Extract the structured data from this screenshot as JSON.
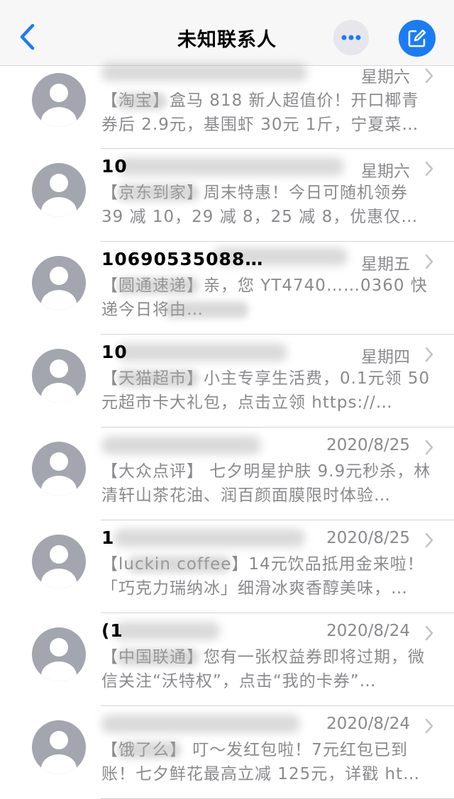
{
  "nav": {
    "title": "未知联系人",
    "back_icon": "chevron-left-icon",
    "more_icon": "ellipsis-icon",
    "compose_icon": "compose-icon",
    "accent_color": "#1a7cf5"
  },
  "messages": [
    {
      "sender": "",
      "date": "星期六",
      "preview": "【淘宝】盒马 818 新人超值价！开口椰青券后 2.9元，基围虾 30元 1斤，宁夏菜…"
    },
    {
      "sender": "10",
      "date": "星期六",
      "preview": "【京东到家】周末特惠！今日可随机领券 39 减 10，29 减 8，25 减 8，优惠仅…"
    },
    {
      "sender": "10690535088…",
      "date": "星期五",
      "preview": "【圆通速递】亲，您 YT4740……0360 快递今日将由…"
    },
    {
      "sender": "10",
      "date": "星期四",
      "preview": "【天猫超市】小主专享生活费，0.1元领 50元超市卡大礼包，点击立领 https://…"
    },
    {
      "sender": "",
      "date": "2020/8/25",
      "preview": "【大众点评】 七夕明星护肤 9.9元秒杀，林清轩山茶花油、润百颜面膜限时体验…"
    },
    {
      "sender": "1",
      "date": "2020/8/25",
      "preview": "【luckin coffee】14元饮品抵用金来啦！「巧克力瑞纳冰」细滑冰爽香醇美味，…"
    },
    {
      "sender": "(1",
      "date": "2020/8/24",
      "preview": "【中国联通】您有一张权益券即将过期，微信关注“沃特权”，点击“我的卡券”…"
    },
    {
      "sender": "",
      "date": "2020/8/24",
      "preview": "【饿了么】 叮～发红包啦！7元红包已到账！七夕鲜花最高立减 125元，详戳 ht…"
    }
  ]
}
